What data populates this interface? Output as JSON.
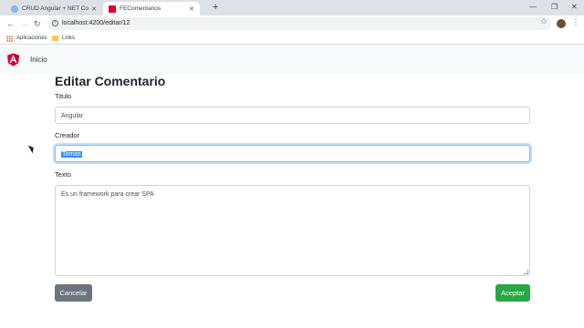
{
  "browser": {
    "tabs": [
      {
        "title": "CRUD Angular + NET Core | Prez",
        "active": false,
        "favicon_color": "#8ab4f8"
      },
      {
        "title": "FEComentarios",
        "active": true,
        "favicon_color": "#dd0031"
      }
    ],
    "new_tab_icon": "plus-icon",
    "window_controls": [
      "minimize-icon",
      "maximize-icon",
      "close-icon"
    ],
    "address": "localhost:4200/editar/12",
    "bookmarks": [
      {
        "label": "Aplicaciones",
        "icon": "apps-grid-icon"
      },
      {
        "label": "Links",
        "icon": "folder-icon"
      }
    ]
  },
  "app": {
    "nav_link": "Inicio",
    "brand_color": "#dd0031"
  },
  "form": {
    "title": "Editar Comentario",
    "fields": {
      "titulo": {
        "label": "Titulo",
        "value": "Angular"
      },
      "creador": {
        "label": "Creador",
        "value": "Tomas"
      },
      "texto": {
        "label": "Texto",
        "value": "Es un framework para crear SPA"
      }
    },
    "cancel_label": "Cancelar",
    "accept_label": "Aceptar",
    "cancel_color": "#6c757d",
    "accept_color": "#28a745"
  }
}
